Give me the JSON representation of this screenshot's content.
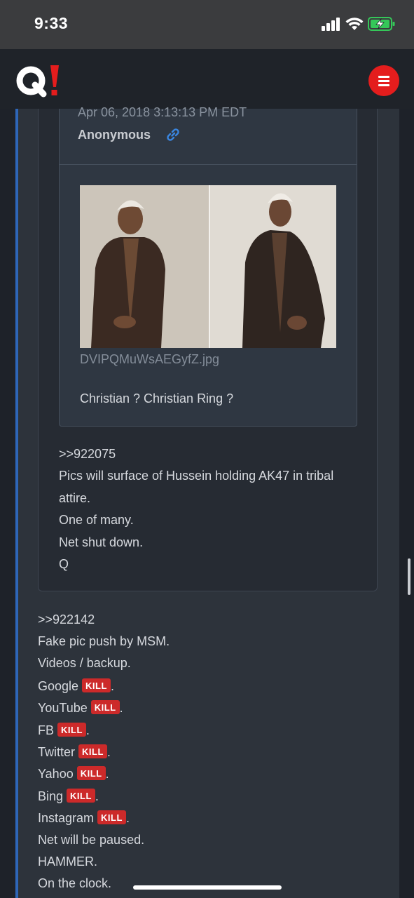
{
  "status_bar": {
    "time": "9:33",
    "icons": [
      "cellular-signal-icon",
      "wifi-icon",
      "battery-charging-icon"
    ],
    "battery_color": "#35c759"
  },
  "app_bar": {
    "logo": "Q!",
    "logo_colors": {
      "q": "#ffffff",
      "bang": "#e41d1d"
    },
    "menu_icon": "hamburger-menu-icon",
    "menu_color": "#e41d1d"
  },
  "quoted_post": {
    "date": "Apr 06, 2018 3:13:13 PM EDT",
    "author": "Anonymous",
    "image_filename": "DVIPQMuWsAEGyfZ.jpg",
    "text": "Christian ? Christian Ring ?"
  },
  "inner_post": {
    "lines": [
      ">>922075",
      "Pics will surface of Hussein holding AK47 in tribal",
      "attire.",
      "One of many.",
      "Net shut down.",
      "Q"
    ]
  },
  "outer_post": {
    "lines": [
      {
        "text": ">>922142"
      },
      {
        "text": "Fake pic push by MSM."
      },
      {
        "text": "Videos / backup."
      },
      {
        "text": "Google",
        "tag": "KILL",
        "suffix": "."
      },
      {
        "text": "YouTube",
        "tag": "KILL",
        "suffix": "."
      },
      {
        "text": "FB",
        "tag": "KILL",
        "suffix": "."
      },
      {
        "text": "Twitter",
        "tag": "KILL",
        "suffix": "."
      },
      {
        "text": "Yahoo",
        "tag": "KILL",
        "suffix": "."
      },
      {
        "text": "Bing",
        "tag": "KILL",
        "suffix": "."
      },
      {
        "text": "Instagram",
        "tag": "KILL",
        "suffix": "."
      },
      {
        "text": "Net will be paused."
      },
      {
        "text": "HAMMER."
      },
      {
        "text": "On the clock."
      }
    ]
  },
  "colors": {
    "page_bg": "#1e2229",
    "post_accent": "#2e66b8",
    "kill_badge": "#cc2a2a",
    "link_icon": "#3a86e0"
  }
}
